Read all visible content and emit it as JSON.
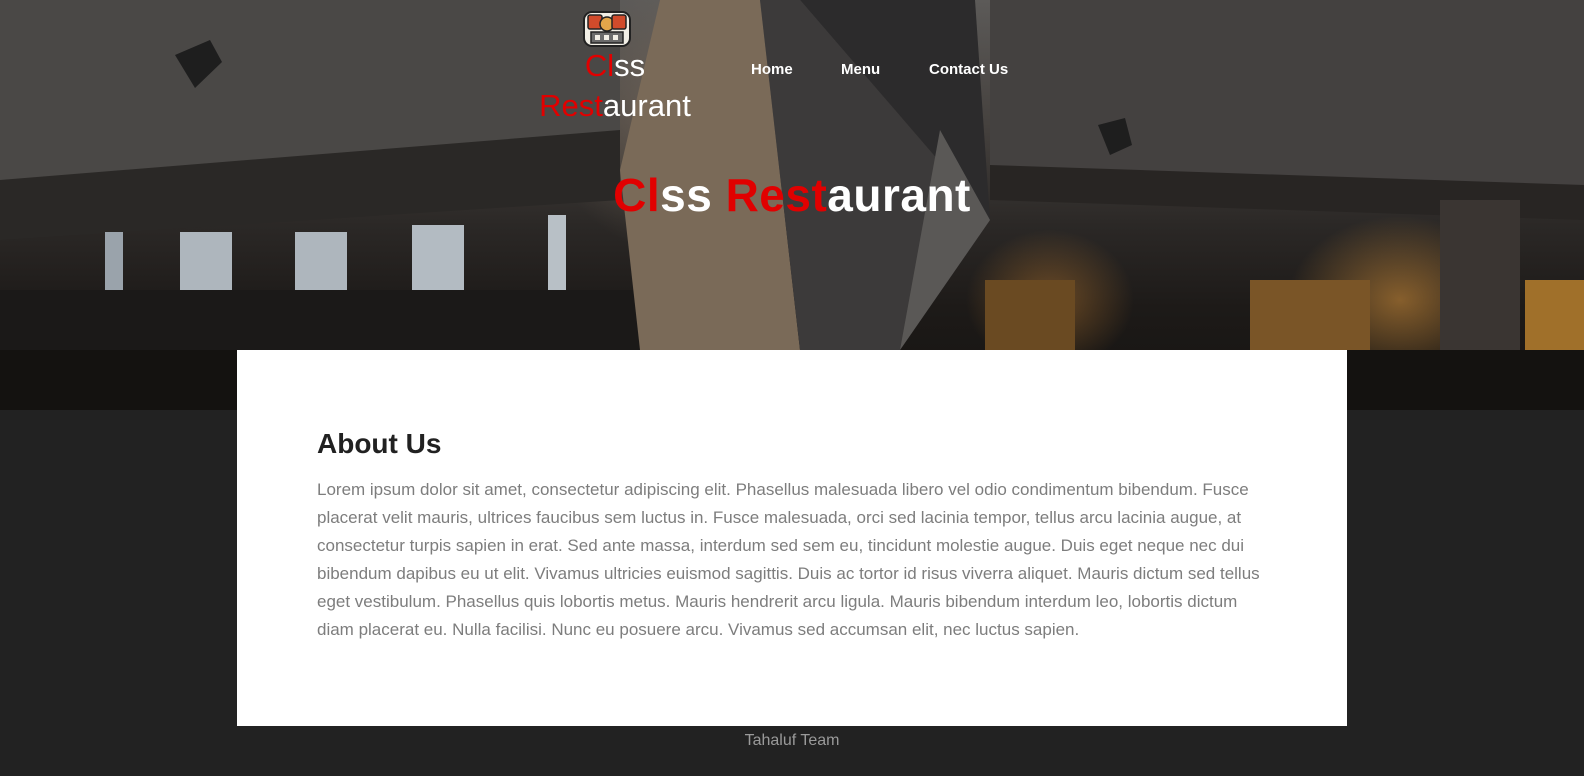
{
  "brand": {
    "part1_red": "Cl",
    "part1_white": "ss",
    "part2_red": "Rest",
    "part2_white": "aurant"
  },
  "nav": {
    "items": [
      "Home",
      "Menu",
      "Contact Us"
    ]
  },
  "hero": {
    "title_red1": "Cl",
    "title_white1": "ss ",
    "title_red2": "Rest",
    "title_white2": "aurant"
  },
  "about": {
    "heading": "About Us",
    "body": "Lorem ipsum dolor sit amet, consectetur adipiscing elit. Phasellus malesuada libero vel odio condimentum bibendum. Fusce placerat velit mauris, ultrices faucibus sem luctus in. Fusce malesuada, orci sed lacinia tempor, tellus arcu lacinia augue, at consectetur turpis sapien in erat. Sed ante massa, interdum sed sem eu, tincidunt molestie augue. Duis eget neque nec dui bibendum dapibus eu ut elit. Vivamus ultricies euismod sagittis. Duis ac tortor id risus viverra aliquet. Mauris dictum sed tellus eget vestibulum. Phasellus quis lobortis metus. Mauris hendrerit arcu ligula. Mauris bibendum interdum leo, lobortis dictum diam placerat eu. Nulla facilisi. Nunc eu posuere arcu. Vivamus sed accumsan elit, nec luctus sapien."
  },
  "footer": {
    "text": "Tahaluf Team"
  },
  "colors": {
    "accent": "#e10000",
    "page_bg": "#222222",
    "card_bg": "#ffffff",
    "body_text": "#7d7d7d"
  },
  "icons": {
    "logo": "restaurant-logo-icon"
  }
}
